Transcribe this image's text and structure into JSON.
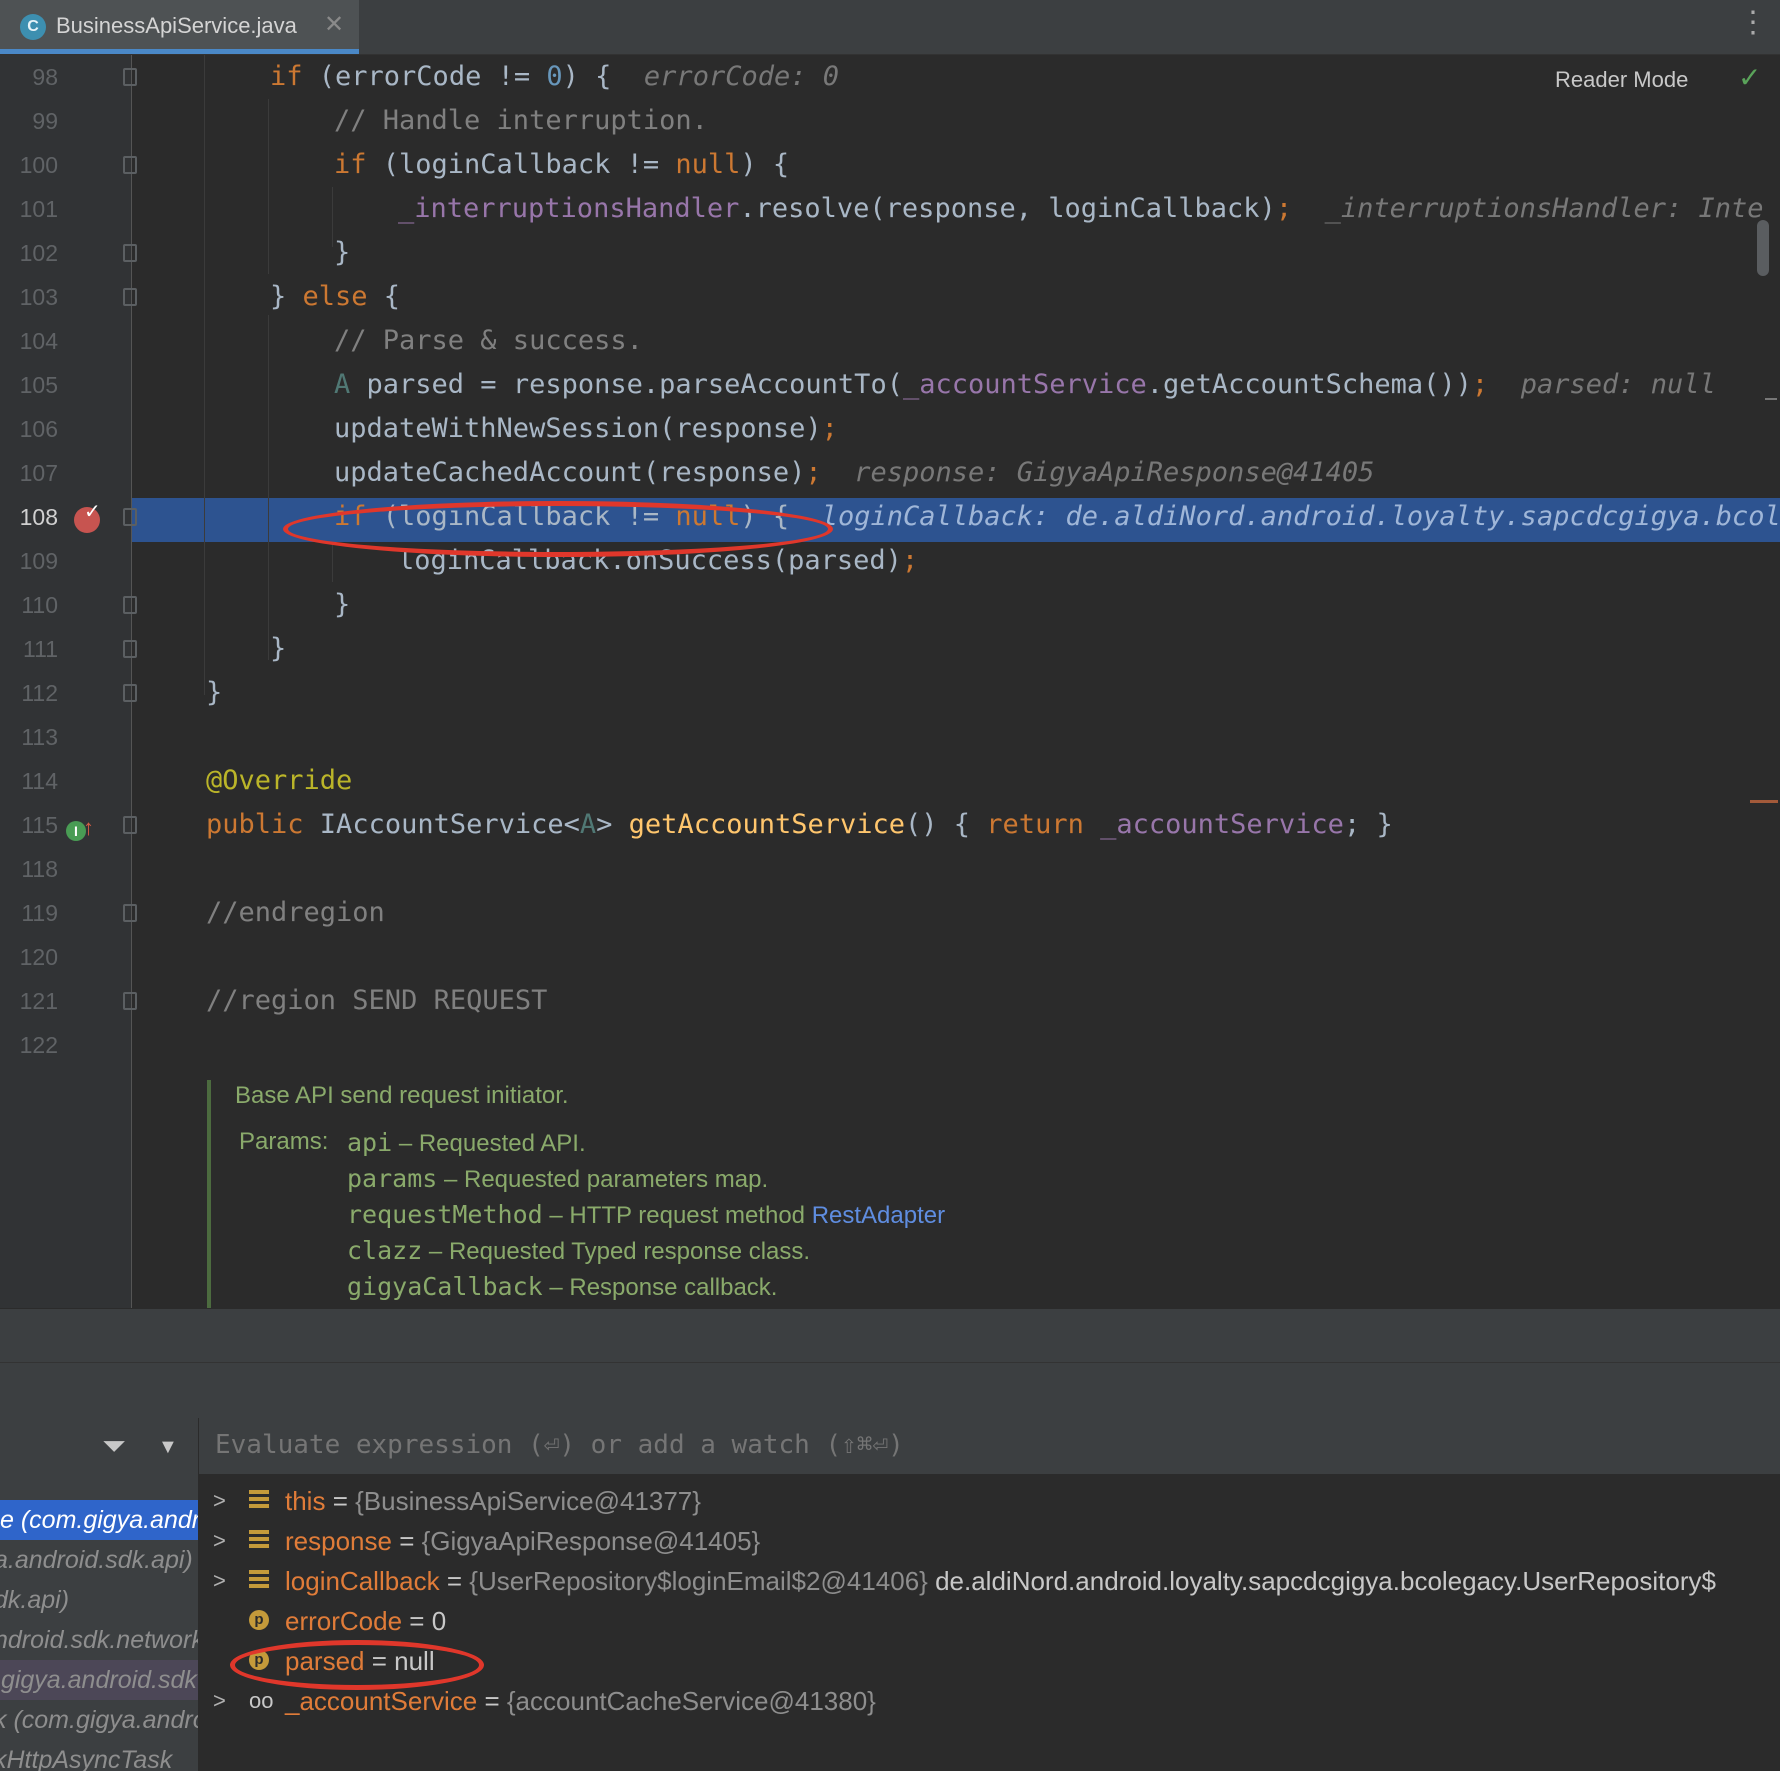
{
  "tab": {
    "icon": "C",
    "label": "BusinessApiService.java",
    "close": "✕"
  },
  "editor": {
    "reader_mode": "Reader Mode",
    "lines": [
      {
        "n": "98"
      },
      {
        "n": "99"
      },
      {
        "n": "100"
      },
      {
        "n": "101"
      },
      {
        "n": "102"
      },
      {
        "n": "103"
      },
      {
        "n": "104"
      },
      {
        "n": "105"
      },
      {
        "n": "106"
      },
      {
        "n": "107"
      },
      {
        "n": "108"
      },
      {
        "n": "109"
      },
      {
        "n": "110"
      },
      {
        "n": "111"
      },
      {
        "n": "112"
      },
      {
        "n": "113"
      },
      {
        "n": "114"
      },
      {
        "n": "115"
      },
      {
        "n": "118"
      },
      {
        "n": "119"
      },
      {
        "n": "120"
      },
      {
        "n": "121"
      },
      {
        "n": "122"
      }
    ],
    "code": {
      "l98_a": "if",
      "l98_b": " (errorCode != ",
      "l98_c": "0",
      "l98_d": ") {",
      "l98_hint": "errorCode: 0",
      "l99": "// Handle interruption.",
      "l100_a": "if",
      "l100_b": " (loginCallback != ",
      "l100_c": "null",
      "l100_d": ") {",
      "l101_a": "_interruptionsHandler",
      "l101_b": ".resolve(response, loginCallback)",
      "l101_c": ";",
      "l101_hint": "_interruptionsHandler: Inte",
      "l102": "}",
      "l103_a": "} ",
      "l103_b": "else",
      "l103_c": " {",
      "l104": "// Parse & success.",
      "l105_a": "A",
      "l105_b": " parsed = response.parseAccountTo(",
      "l105_c": "_accountService",
      "l105_d": ".getAccountSchema())",
      "l105_e": ";",
      "l105_hint": "parsed: null",
      "l106_a": "updateWithNewSession(response)",
      "l106_b": ";",
      "l107_a": "updateCachedAccount(response)",
      "l107_b": ";",
      "l107_hint": "response: GigyaApiResponse@41405",
      "l108_a": "if",
      "l108_b": " (loginCallback != ",
      "l108_c": "null",
      "l108_d": ") {",
      "l108_hint": "loginCallback: de.aldiNord.android.loyalty.sapcdcgigya.bcole",
      "l109_a": "loginCallback.onSuccess(parsed)",
      "l109_b": ";",
      "l110": "}",
      "l111": "}",
      "l112": "}",
      "l114": "@Override",
      "l115_a": "public",
      "l115_b": " IAccountService<",
      "l115_c": "A",
      "l115_d": "> ",
      "l115_e": "getAccountService",
      "l115_f": "() { ",
      "l115_g": "return",
      "l115_h": " ",
      "l115_i": "_accountService",
      "l115_j": "; }",
      "l119": "//endregion",
      "l121": "//region SEND REQUEST"
    },
    "doc": {
      "summary": "Base API send request initiator.",
      "params_label": "Params:",
      "params": [
        {
          "name": "api",
          "desc": " – Requested API."
        },
        {
          "name": "params",
          "desc": " – Requested parameters map."
        },
        {
          "name": "requestMethod",
          "desc": " – HTTP request method ",
          "link": "RestAdapter"
        },
        {
          "name": "clazz",
          "desc": " – Requested Typed response class."
        },
        {
          "name": "gigyaCallback",
          "desc": " – Response callback."
        }
      ]
    }
  },
  "debugger": {
    "eval_placeholder": "Evaluate expression (⏎) or add a watch (⇧⌘⏎)",
    "frames": [
      "e (com.gigya.android",
      "a.android.sdk.api)",
      "dk.api)",
      "ndroid.sdk.network",
      ".gigya.android.sdk",
      "k (com.gigya.android",
      "kHttpAsyncTask"
    ],
    "variables": [
      {
        "name": "this",
        "eq": " = ",
        "value": "{BusinessApiService@41377}",
        "extra": ""
      },
      {
        "name": "response",
        "eq": " = ",
        "value": "{GigyaApiResponse@41405}",
        "extra": ""
      },
      {
        "name": "loginCallback",
        "eq": " = ",
        "value": "{UserRepository$loginEmail$2@41406}",
        "extra": " de.aldiNord.android.loyalty.sapcdcgigya.bcolegacy.UserRepository$"
      },
      {
        "name": "errorCode",
        "eq": " = ",
        "value": "0",
        "extra": ""
      },
      {
        "name": "parsed",
        "eq": " = ",
        "value": "null",
        "extra": ""
      },
      {
        "name": "_accountService",
        "eq": " = ",
        "value": "{accountCacheService@41380}",
        "extra": ""
      }
    ]
  },
  "colors": {
    "accent": "#4a88c7",
    "highlight": "#2d5390",
    "annotation_circle": "#e0372b"
  }
}
